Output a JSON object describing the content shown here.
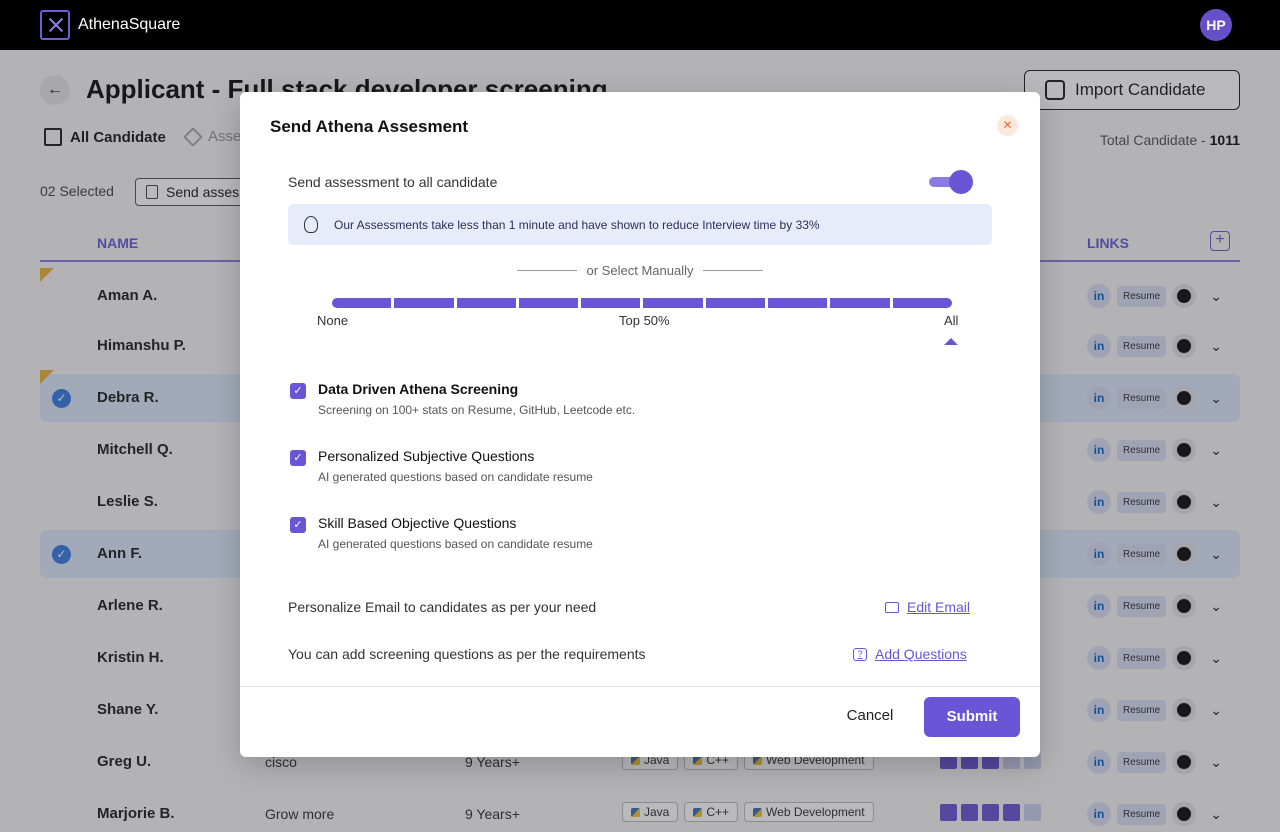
{
  "app": {
    "name": "AthenaSquare",
    "avatar_initials": "HP"
  },
  "header": {
    "title": "Applicant - Full stack developer screening",
    "import_label": "Import Candidate",
    "tab_all": "All Candidate",
    "tab_assess": "Asse",
    "total_label": "Total Candidate",
    "total_count": "1011",
    "selected_label": "02 Selected",
    "send_assess_label": "Send asses"
  },
  "table": {
    "col_name": "NAME",
    "col_links": "LINKS",
    "resume_label": "Resume",
    "rows": [
      {
        "name": "Aman A."
      },
      {
        "name": "Himanshu P."
      },
      {
        "name": "Debra R."
      },
      {
        "name": "Mitchell Q."
      },
      {
        "name": "Leslie S."
      },
      {
        "name": "Ann F."
      },
      {
        "name": "Arlene R."
      },
      {
        "name": "Kristin H."
      },
      {
        "name": "Shane Y."
      },
      {
        "name": "Greg U.",
        "company": "cisco",
        "experience": "9 Years+",
        "skills": [
          "Java",
          "C++",
          "Web Development"
        ],
        "rating": 3
      },
      {
        "name": "Marjorie B.",
        "company": "Grow more",
        "experience": "9 Years+",
        "skills": [
          "Java",
          "C++",
          "Web Development"
        ],
        "rating": 4
      }
    ]
  },
  "modal": {
    "title": "Send Athena Assesment",
    "send_all_label": "Send assessment to all candidate",
    "info": "Our Assessments take less than 1 minute and have shown to reduce Interview time by 33%",
    "or_select": "or Select Manually",
    "slider": {
      "label_none": "None",
      "label_mid": "Top 50%",
      "label_all": "All",
      "segments": 10,
      "selected": "All"
    },
    "options": [
      {
        "title": "Data Driven Athena Screening",
        "sub": "Screening on 100+ stats on Resume, GitHub, Leetcode etc.",
        "checked": true
      },
      {
        "title": "Personalized Subjective Questions",
        "sub": "AI generated questions based on candidate resume",
        "checked": true
      },
      {
        "title": "Skill Based Objective Questions",
        "sub": "AI generated questions based on candidate resume",
        "checked": true
      }
    ],
    "email_label": "Personalize Email to candidates as per your need",
    "edit_email": "Edit Email",
    "questions_label": "You can add screening questions as per the requirements",
    "add_questions": "Add Questions",
    "cancel": "Cancel",
    "submit": "Submit"
  },
  "colors": {
    "accent": "#6a55d6",
    "selected_row": "#dce8fb"
  }
}
